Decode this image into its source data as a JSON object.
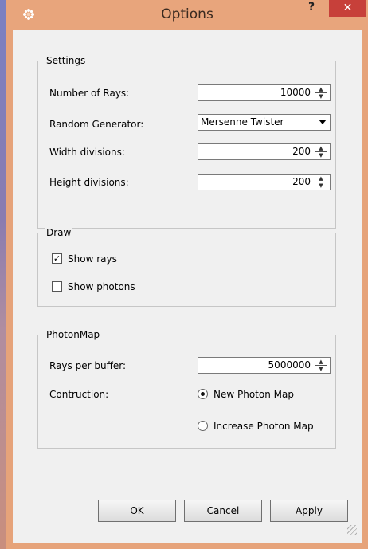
{
  "window": {
    "title": "Options",
    "help_label": "?",
    "close_label": "✕",
    "app_icon": "gear-flower-icon",
    "accent": "#e8a57c",
    "close_color": "#c7403a"
  },
  "settings": {
    "group_label": "Settings",
    "rays_label": "Number of Rays:",
    "rays_value": "10000",
    "generator_label": "Random Generator:",
    "generator_value": "Mersenne Twister",
    "width_label": "Width divisions:",
    "width_value": "200",
    "height_label": "Height divisions:",
    "height_value": "200"
  },
  "draw": {
    "group_label": "Draw",
    "show_rays_label": "Show rays",
    "show_rays_checked": true,
    "show_photons_label": "Show photons",
    "show_photons_checked": false
  },
  "photonmap": {
    "group_label": "PhotonMap",
    "buffer_label": "Rays per buffer:",
    "buffer_value": "5000000",
    "construction_label": "Contruction:",
    "option_new": "New Photon Map",
    "option_increase": "Increase Photon Map",
    "selected": "new"
  },
  "buttons": {
    "ok": "OK",
    "cancel": "Cancel",
    "apply": "Apply"
  }
}
